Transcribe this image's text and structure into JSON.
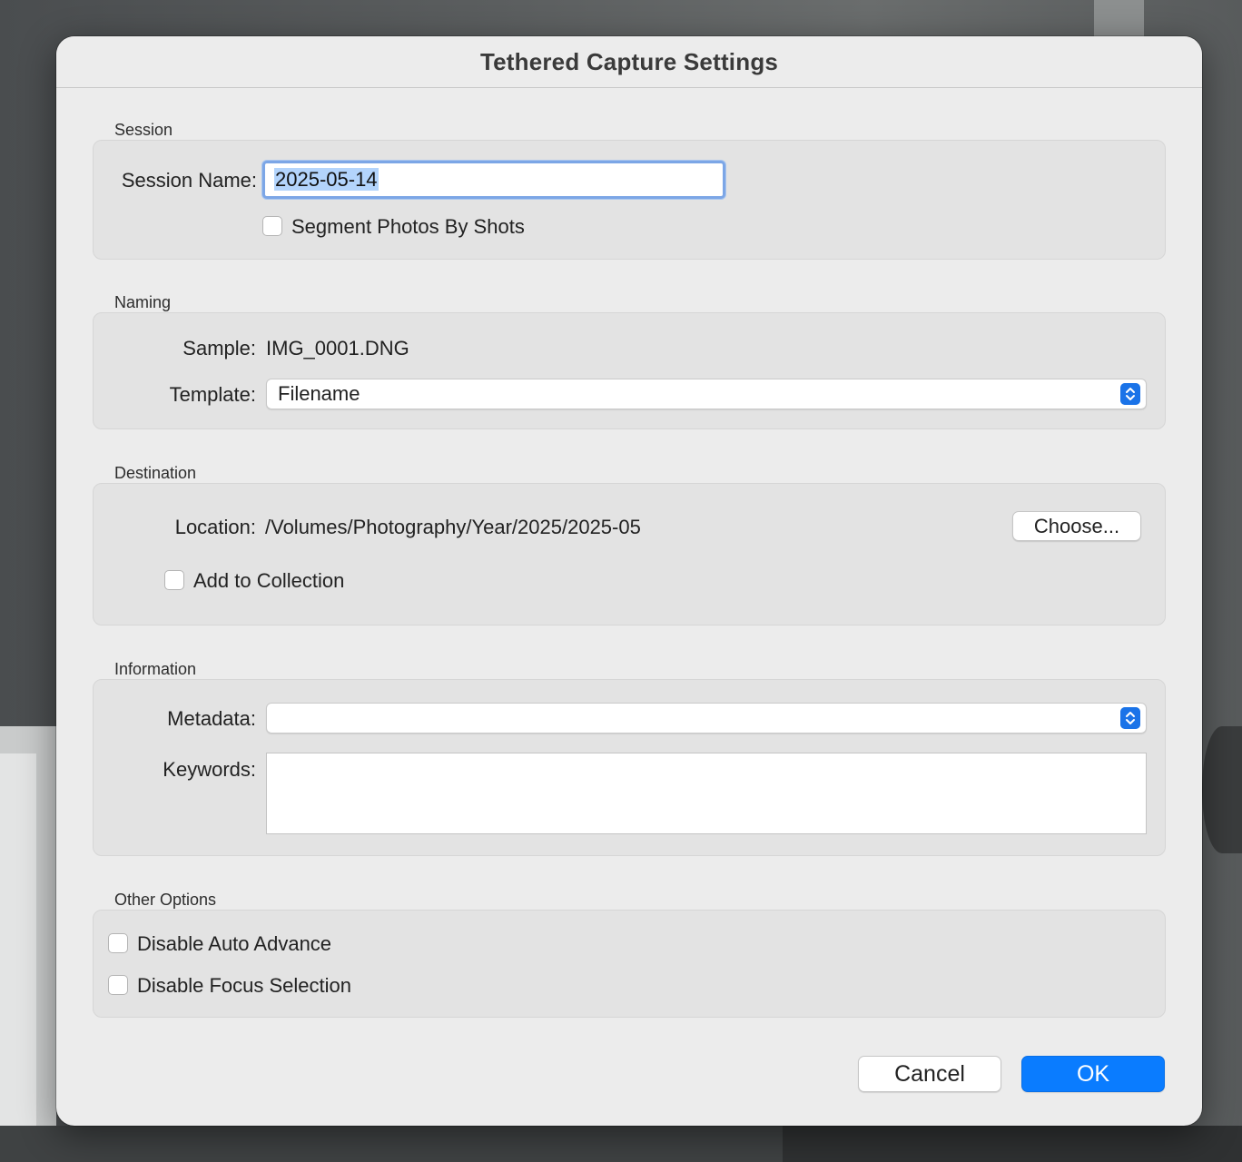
{
  "dialog": {
    "title": "Tethered Capture Settings"
  },
  "session": {
    "section_label": "Session",
    "name_label": "Session Name:",
    "name_value": "2025-05-14",
    "segment_label": "Segment Photos By Shots"
  },
  "naming": {
    "section_label": "Naming",
    "sample_label": "Sample:",
    "sample_value": "IMG_0001.DNG",
    "template_label": "Template:",
    "template_value": "Filename"
  },
  "destination": {
    "section_label": "Destination",
    "location_label": "Location:",
    "location_value": "/Volumes/Photography/Year/2025/2025-05",
    "choose_label": "Choose...",
    "add_collection_label": "Add to Collection"
  },
  "information": {
    "section_label": "Information",
    "metadata_label": "Metadata:",
    "metadata_value": "",
    "keywords_label": "Keywords:",
    "keywords_value": ""
  },
  "other": {
    "section_label": "Other Options",
    "auto_advance_label": "Disable Auto Advance",
    "focus_selection_label": "Disable Focus Selection"
  },
  "buttons": {
    "cancel": "Cancel",
    "ok": "OK"
  },
  "colors": {
    "accent": "#0a7cff",
    "focus_ring": "#7ca6e6",
    "selection": "#b3d4fc"
  }
}
